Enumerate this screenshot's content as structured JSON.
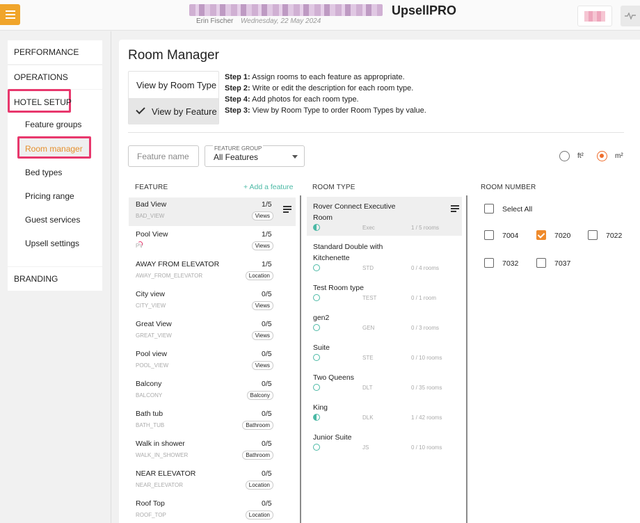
{
  "header": {
    "app_name": "UpsellPRO",
    "user_name": "Erin Fischer",
    "date": "Wednesday, 22 May 2024"
  },
  "icons": {
    "menu": "hamburger-menu-icon",
    "activity": "activity-pulse-icon",
    "edit": "edit-list-icon",
    "check": "checkmark-icon"
  },
  "colors": {
    "accent_orange": "#f0a52b",
    "active_item": "#e5902e",
    "highlight_pink": "#e8386d",
    "teal": "#4bb9a5",
    "radio_selected": "#ef6c2b"
  },
  "sidebar": {
    "performance": "PERFORMANCE",
    "operations": "OPERATIONS",
    "hotel_setup": "HOTEL SETUP",
    "items": [
      "Feature groups",
      "Room manager",
      "Bed types",
      "Pricing range",
      "Guest services",
      "Upsell settings"
    ],
    "active_item": "Room manager",
    "branding": "BRANDING"
  },
  "main": {
    "title": "Room Manager",
    "view_by_room_type": "View by Room Type",
    "view_by_feature": "View by Feature",
    "selected_view": "View by Feature",
    "steps": [
      {
        "label": "Step 1:",
        "text": " Assign rooms to each feature as appropriate."
      },
      {
        "label": "Step 2:",
        "text": " Write or edit the description for each room type."
      },
      {
        "label": "Step 4:",
        "text": " Add photos for each room type."
      },
      {
        "label": "Step 3:",
        "text": " View by Room Type to order Room Types by value."
      }
    ],
    "feature_name_placeholder": "Feature name",
    "feature_group_label": "FEATURE GROUP",
    "feature_group_value": "All Features",
    "unit_ft": "ft²",
    "unit_m": "m²",
    "selected_unit": "m²"
  },
  "columns": {
    "feature": "FEATURE",
    "add_feature": "+ Add a feature",
    "room_type": "ROOM TYPE",
    "room_number": "ROOM NUMBER"
  },
  "features": [
    {
      "name": "Bad View",
      "code": "BAD_VIEW",
      "count": "1/5",
      "group": "Views",
      "selected": true
    },
    {
      "name": "Pool View",
      "code": "PV",
      "count": "1/5",
      "group": "Views"
    },
    {
      "name": "AWAY FROM ELEVATOR",
      "code": "AWAY_FROM_ELEVATOR",
      "count": "1/5",
      "group": "Location"
    },
    {
      "name": "City view",
      "code": "CITY_VIEW",
      "count": "0/5",
      "group": "Views"
    },
    {
      "name": "Great View",
      "code": "GREAT_VIEW",
      "count": "0/5",
      "group": "Views"
    },
    {
      "name": "Pool view",
      "code": "POOL_VIEW",
      "count": "0/5",
      "group": "Views"
    },
    {
      "name": "Balcony",
      "code": "BALCONY",
      "count": "0/5",
      "group": "Balcony"
    },
    {
      "name": "Bath tub",
      "code": "BATH_TUB",
      "count": "0/5",
      "group": "Bathroom"
    },
    {
      "name": "Walk in shower",
      "code": "WALK_IN_SHOWER",
      "count": "0/5",
      "group": "Bathroom"
    },
    {
      "name": "NEAR ELEVATOR",
      "code": "NEAR_ELEVATOR",
      "count": "0/5",
      "group": "Location"
    },
    {
      "name": "Roof Top",
      "code": "ROOF_TOP",
      "count": "0/5",
      "group": "Location"
    }
  ],
  "room_types": [
    {
      "name": "Rover Connect Executive Room",
      "code": "Exec",
      "rooms": "1 / 5 rooms",
      "partial": true,
      "selected": true
    },
    {
      "name": "Standard Double with Kitchenette",
      "code": "STD",
      "rooms": "0 / 4 rooms"
    },
    {
      "name": "Test Room type",
      "code": "TEST",
      "rooms": "0 / 1 room"
    },
    {
      "name": "gen2",
      "code": "GEN",
      "rooms": "0 / 3 rooms"
    },
    {
      "name": "Suite",
      "code": "STE",
      "rooms": "0 / 10 rooms"
    },
    {
      "name": "Two Queens",
      "code": "DLT",
      "rooms": "0 / 35 rooms"
    },
    {
      "name": "King",
      "code": "DLK",
      "rooms": "1 / 42 rooms",
      "partial": true
    },
    {
      "name": "Junior Suite",
      "code": "JS",
      "rooms": "0 / 10 rooms"
    }
  ],
  "room_numbers": {
    "select_all": "Select All",
    "rooms": [
      {
        "number": "7004",
        "checked": false
      },
      {
        "number": "7020",
        "checked": true
      },
      {
        "number": "7022",
        "checked": false
      },
      {
        "number": "7032",
        "checked": false
      },
      {
        "number": "7037",
        "checked": false
      }
    ]
  }
}
